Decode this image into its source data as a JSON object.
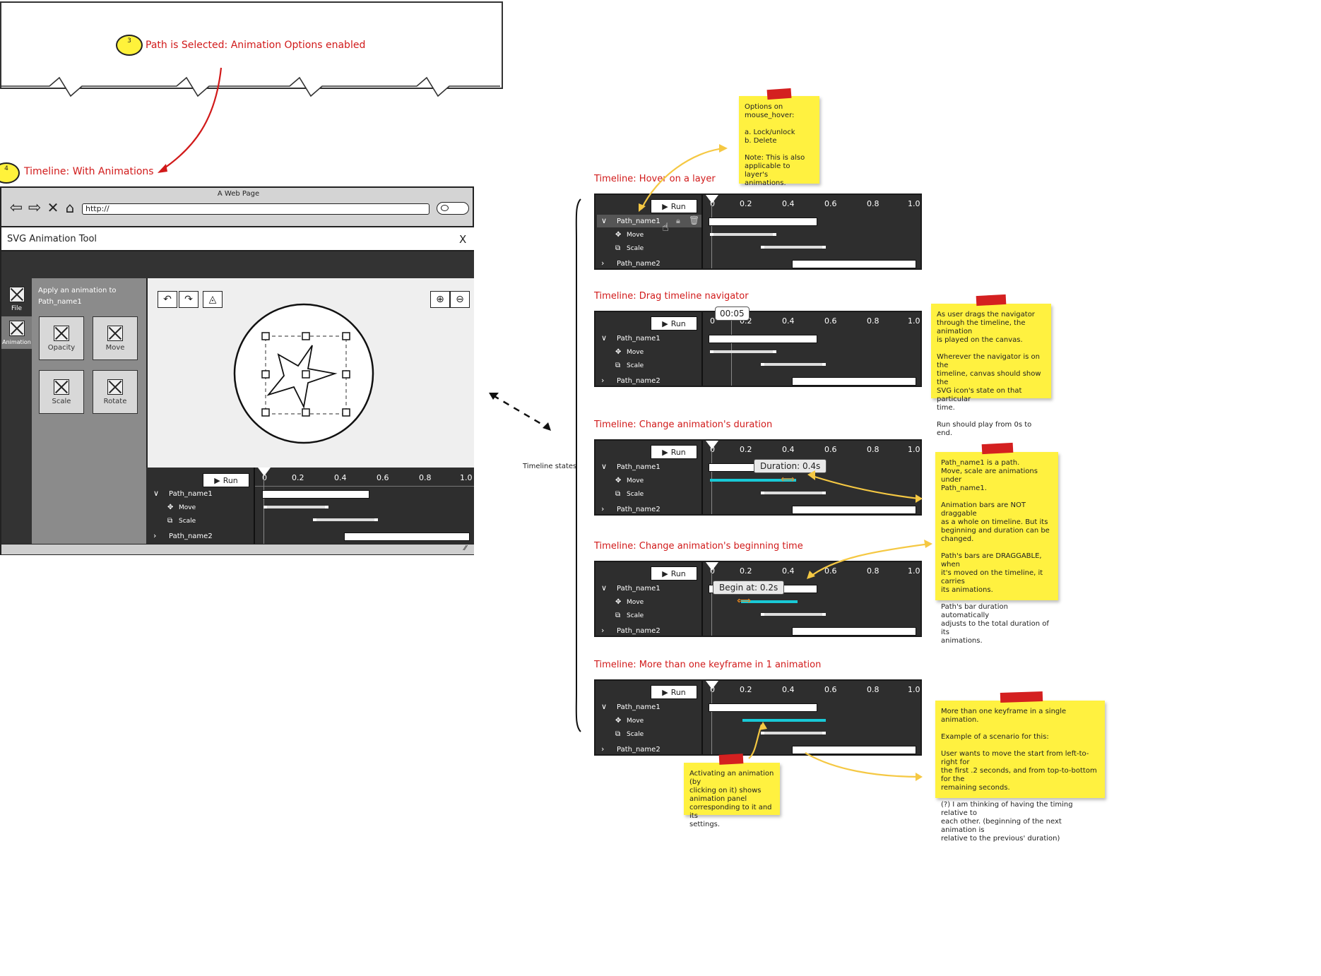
{
  "callout": {
    "badge": "3",
    "text": "Path is Selected: Animation Options enabled"
  },
  "section4": {
    "badge": "4",
    "title": "Timeline: With Animations"
  },
  "browser": {
    "window_title": "A Web Page",
    "url": "http://",
    "app_title": "SVG Animation Tool",
    "close_label": "X",
    "side_tabs": [
      {
        "label": "File"
      },
      {
        "label": "Animation"
      }
    ],
    "panel_title": "Apply an animation to\nPath_name1",
    "panel_items": [
      {
        "label": "Opacity"
      },
      {
        "label": "Move"
      },
      {
        "label": "Scale"
      },
      {
        "label": "Rotate"
      }
    ]
  },
  "timeline": {
    "run_label": "Run",
    "ticks": [
      "0",
      "0.2",
      "0.4",
      "0.6",
      "0.8",
      "1.0"
    ],
    "layers": [
      {
        "name": "Path_name1"
      },
      {
        "name": "Path_name2"
      }
    ],
    "animations": [
      {
        "name": "Move"
      },
      {
        "name": "Scale"
      }
    ]
  },
  "timeline_states_label": "Timeline states",
  "states": [
    {
      "title": "Timeline: Hover on a layer"
    },
    {
      "title": "Timeline: Drag timeline navigator",
      "navigator_time": "00:05"
    },
    {
      "title": "Timeline: Change animation's duration",
      "tooltip": "Duration: 0.4s"
    },
    {
      "title": "Timeline: Change animation's beginning time",
      "tooltip": "Begin at: 0.2s"
    },
    {
      "title": "Timeline: More than one keyframe in 1 animation"
    }
  ],
  "notes": {
    "hover": "Options on\nmouse_hover:\n\na. Lock/unlock\nb. Delete\n\nNote: This is also\napplicable to layer's\nanimations.",
    "navigator": "As user drags the navigator\nthrough the timeline, the animation\nis played on the canvas.\n\nWherever the navigator is on the\ntimeline, canvas should show the\nSVG icon's state on that particular\ntime.\n\nRun should play from 0s to end.",
    "path": "Path_name1 is a path.\nMove, scale are animations under\nPath_name1.\n\nAnimation bars are NOT draggable\nas a whole on timeline. But its\nbeginning and duration can be\nchanged.\n\nPath's bars are DRAGGABLE, when\nit's moved on the timeline, it carries\nits animations.\n\nPath's bar duration automatically\nadjusts to the total duration of its\nanimations.",
    "keyframes": "More than one keyframe in a single animation.\n\nExample of a scenario for this:\n\nUser wants to move the start from left-to-right for\nthe first .2 seconds, and from top-to-bottom for the\nremaining seconds.\n\n(?) I am thinking of having the timing relative to\neach other. (beginning of the next animation is\nrelative to the previous' duration)",
    "activating": "Activating an animation (by\nclicking on it) shows\nanimation panel\ncorresponding to it and its\nsettings."
  },
  "colors": {
    "annotation_red": "#d11a1a",
    "sticky_yellow": "#fff140",
    "arrow_yellow": "#f5c843",
    "keyframe_cyan": "#19c9d6",
    "handle_orange": "#f08a1c"
  }
}
